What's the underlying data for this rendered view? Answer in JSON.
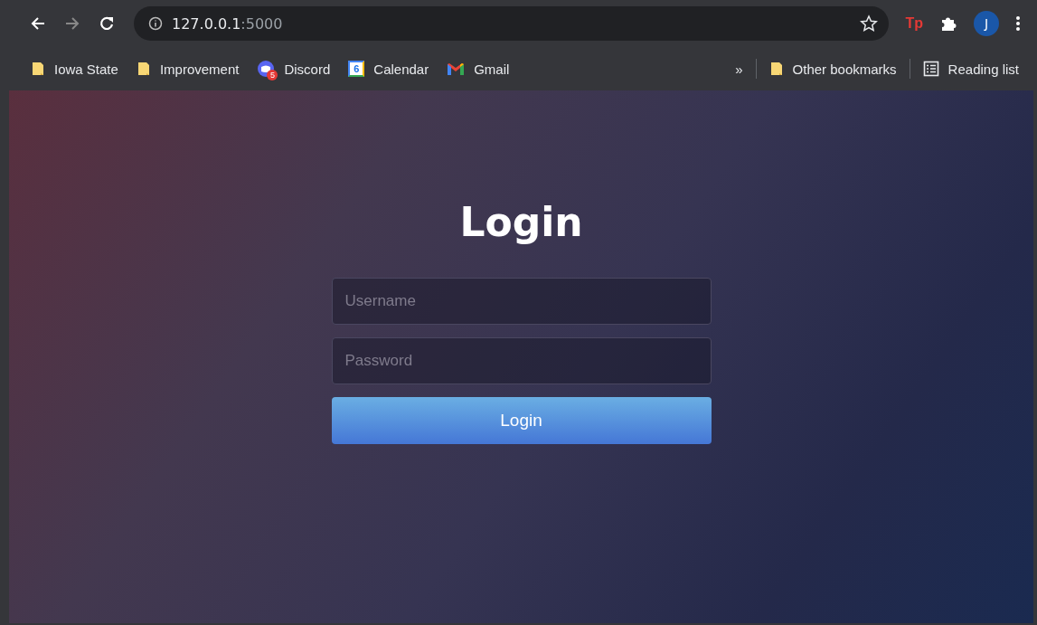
{
  "toolbar": {
    "url_host": "127.0.0.1",
    "url_port": ":5000",
    "extension_label": "Tp",
    "avatar_letter": "J"
  },
  "bookmarks": [
    {
      "kind": "folder",
      "label": "Iowa State"
    },
    {
      "kind": "folder",
      "label": "Improvement"
    },
    {
      "kind": "discord",
      "label": "Discord",
      "badge": "5"
    },
    {
      "kind": "calendar",
      "label": "Calendar",
      "badge": "6"
    },
    {
      "kind": "gmail",
      "label": "Gmail"
    }
  ],
  "bookmarks_overflow": "»",
  "bookmarks_right": [
    {
      "kind": "folder",
      "label": "Other bookmarks"
    },
    {
      "kind": "reading",
      "label": "Reading list"
    }
  ],
  "login": {
    "title": "Login",
    "fields": [
      {
        "placeholder": "Username"
      },
      {
        "placeholder": "Password"
      }
    ],
    "button": "Login"
  }
}
